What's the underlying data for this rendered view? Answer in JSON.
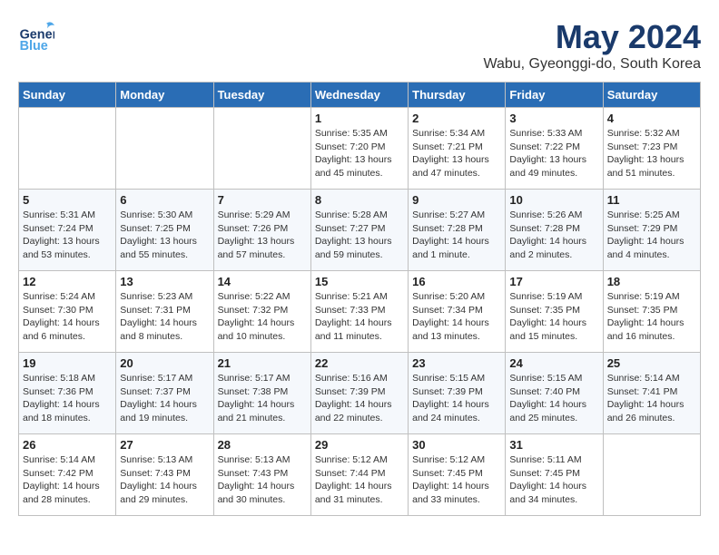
{
  "header": {
    "logo_general": "General",
    "logo_blue": "Blue",
    "month": "May 2024",
    "location": "Wabu, Gyeonggi-do, South Korea"
  },
  "days_of_week": [
    "Sunday",
    "Monday",
    "Tuesday",
    "Wednesday",
    "Thursday",
    "Friday",
    "Saturday"
  ],
  "weeks": [
    [
      {
        "day": "",
        "detail": ""
      },
      {
        "day": "",
        "detail": ""
      },
      {
        "day": "",
        "detail": ""
      },
      {
        "day": "1",
        "detail": "Sunrise: 5:35 AM\nSunset: 7:20 PM\nDaylight: 13 hours\nand 45 minutes."
      },
      {
        "day": "2",
        "detail": "Sunrise: 5:34 AM\nSunset: 7:21 PM\nDaylight: 13 hours\nand 47 minutes."
      },
      {
        "day": "3",
        "detail": "Sunrise: 5:33 AM\nSunset: 7:22 PM\nDaylight: 13 hours\nand 49 minutes."
      },
      {
        "day": "4",
        "detail": "Sunrise: 5:32 AM\nSunset: 7:23 PM\nDaylight: 13 hours\nand 51 minutes."
      }
    ],
    [
      {
        "day": "5",
        "detail": "Sunrise: 5:31 AM\nSunset: 7:24 PM\nDaylight: 13 hours\nand 53 minutes."
      },
      {
        "day": "6",
        "detail": "Sunrise: 5:30 AM\nSunset: 7:25 PM\nDaylight: 13 hours\nand 55 minutes."
      },
      {
        "day": "7",
        "detail": "Sunrise: 5:29 AM\nSunset: 7:26 PM\nDaylight: 13 hours\nand 57 minutes."
      },
      {
        "day": "8",
        "detail": "Sunrise: 5:28 AM\nSunset: 7:27 PM\nDaylight: 13 hours\nand 59 minutes."
      },
      {
        "day": "9",
        "detail": "Sunrise: 5:27 AM\nSunset: 7:28 PM\nDaylight: 14 hours\nand 1 minute."
      },
      {
        "day": "10",
        "detail": "Sunrise: 5:26 AM\nSunset: 7:28 PM\nDaylight: 14 hours\nand 2 minutes."
      },
      {
        "day": "11",
        "detail": "Sunrise: 5:25 AM\nSunset: 7:29 PM\nDaylight: 14 hours\nand 4 minutes."
      }
    ],
    [
      {
        "day": "12",
        "detail": "Sunrise: 5:24 AM\nSunset: 7:30 PM\nDaylight: 14 hours\nand 6 minutes."
      },
      {
        "day": "13",
        "detail": "Sunrise: 5:23 AM\nSunset: 7:31 PM\nDaylight: 14 hours\nand 8 minutes."
      },
      {
        "day": "14",
        "detail": "Sunrise: 5:22 AM\nSunset: 7:32 PM\nDaylight: 14 hours\nand 10 minutes."
      },
      {
        "day": "15",
        "detail": "Sunrise: 5:21 AM\nSunset: 7:33 PM\nDaylight: 14 hours\nand 11 minutes."
      },
      {
        "day": "16",
        "detail": "Sunrise: 5:20 AM\nSunset: 7:34 PM\nDaylight: 14 hours\nand 13 minutes."
      },
      {
        "day": "17",
        "detail": "Sunrise: 5:19 AM\nSunset: 7:35 PM\nDaylight: 14 hours\nand 15 minutes."
      },
      {
        "day": "18",
        "detail": "Sunrise: 5:19 AM\nSunset: 7:35 PM\nDaylight: 14 hours\nand 16 minutes."
      }
    ],
    [
      {
        "day": "19",
        "detail": "Sunrise: 5:18 AM\nSunset: 7:36 PM\nDaylight: 14 hours\nand 18 minutes."
      },
      {
        "day": "20",
        "detail": "Sunrise: 5:17 AM\nSunset: 7:37 PM\nDaylight: 14 hours\nand 19 minutes."
      },
      {
        "day": "21",
        "detail": "Sunrise: 5:17 AM\nSunset: 7:38 PM\nDaylight: 14 hours\nand 21 minutes."
      },
      {
        "day": "22",
        "detail": "Sunrise: 5:16 AM\nSunset: 7:39 PM\nDaylight: 14 hours\nand 22 minutes."
      },
      {
        "day": "23",
        "detail": "Sunrise: 5:15 AM\nSunset: 7:39 PM\nDaylight: 14 hours\nand 24 minutes."
      },
      {
        "day": "24",
        "detail": "Sunrise: 5:15 AM\nSunset: 7:40 PM\nDaylight: 14 hours\nand 25 minutes."
      },
      {
        "day": "25",
        "detail": "Sunrise: 5:14 AM\nSunset: 7:41 PM\nDaylight: 14 hours\nand 26 minutes."
      }
    ],
    [
      {
        "day": "26",
        "detail": "Sunrise: 5:14 AM\nSunset: 7:42 PM\nDaylight: 14 hours\nand 28 minutes."
      },
      {
        "day": "27",
        "detail": "Sunrise: 5:13 AM\nSunset: 7:43 PM\nDaylight: 14 hours\nand 29 minutes."
      },
      {
        "day": "28",
        "detail": "Sunrise: 5:13 AM\nSunset: 7:43 PM\nDaylight: 14 hours\nand 30 minutes."
      },
      {
        "day": "29",
        "detail": "Sunrise: 5:12 AM\nSunset: 7:44 PM\nDaylight: 14 hours\nand 31 minutes."
      },
      {
        "day": "30",
        "detail": "Sunrise: 5:12 AM\nSunset: 7:45 PM\nDaylight: 14 hours\nand 33 minutes."
      },
      {
        "day": "31",
        "detail": "Sunrise: 5:11 AM\nSunset: 7:45 PM\nDaylight: 14 hours\nand 34 minutes."
      },
      {
        "day": "",
        "detail": ""
      }
    ]
  ]
}
